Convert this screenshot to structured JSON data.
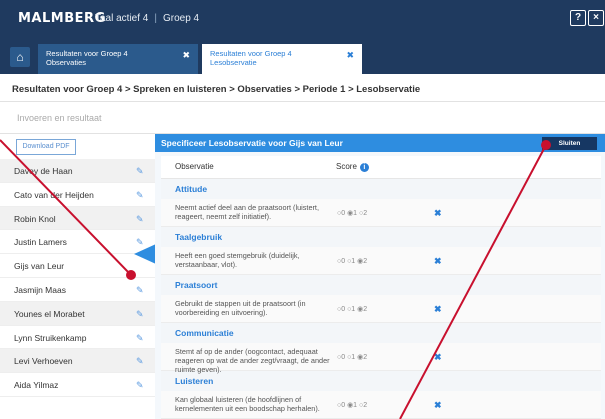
{
  "header": {
    "logo": "MALMBERG",
    "product": "Taal actief 4",
    "group": "Groep 4",
    "help_label": "?",
    "close_label": "×"
  },
  "tabs": [
    {
      "line1": "Resultaten voor Groep 4",
      "line2": "Observaties",
      "close": "✖"
    },
    {
      "line1": "Resultaten voor Groep 4",
      "line2": "Lesobservatie",
      "close": "✖"
    }
  ],
  "breadcrumb": "Resultaten voor Groep 4 > Spreken en luisteren > Observaties > Periode 1 > Lesobservatie",
  "invoeren_label": "Invoeren en resultaat",
  "download_label": "Download PDF",
  "students": [
    "Davey de Haan",
    "Cato van der Heijden",
    "Robin Knol",
    "Justin Lamers",
    "Gijs van Leur",
    "Jasmijn Maas",
    "Younes el Morabet",
    "Lynn Struikenkamp",
    "Levi Verhoeven",
    "Aida Yilmaz"
  ],
  "panel": {
    "title": "Specificeer Lesobservatie voor Gijs van Leur",
    "close_button": "Sluiten",
    "col_observatie": "Observatie",
    "col_score": "Score"
  },
  "sections": [
    {
      "category": "Attitude",
      "text": "Neemt actief deel aan de praatsoort (luistert, reageert, neemt zelf initiatief).",
      "selected": 1
    },
    {
      "category": "Taalgebruik",
      "text": "Heeft een goed stemgebruik (duidelijk, verstaanbaar, vlot).",
      "selected": 2
    },
    {
      "category": "Praatsoort",
      "text": "Gebruikt de stappen uit de praatsoort (in voorbereiding en uitvoering).",
      "selected": 2
    },
    {
      "category": "Communicatie",
      "text": "Stemt af op de ander (oogcontact, adequaat reageren op wat de ander zegt/vraagt, de ander ruimte geven).",
      "selected": 2
    },
    {
      "category": "Luisteren",
      "text": "Kan globaal luisteren (de hoofdlijnen of kernelementen uit een boodschap herhalen).",
      "selected": 1
    }
  ],
  "colors": {
    "accent": "#2e8de0",
    "dark": "#1f3a5f",
    "annotation": "#c8102e"
  },
  "icons": {
    "home": "home-icon",
    "edit": "edit-icon",
    "delete": "delete-icon",
    "info": "info-icon"
  }
}
